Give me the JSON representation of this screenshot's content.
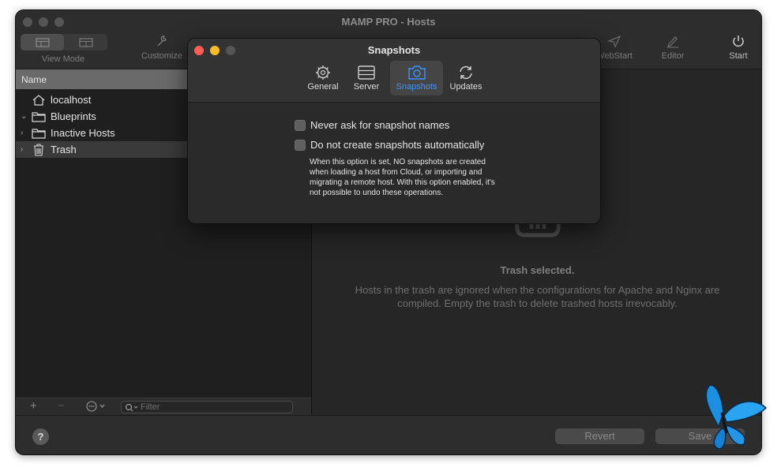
{
  "window": {
    "title": "MAMP PRO - Hosts"
  },
  "toolbar": {
    "view_mode_label": "View Mode",
    "customize_label": "Customize",
    "webstart_label": "WebStart",
    "editor_label": "Editor",
    "start_label": "Start"
  },
  "sidebar": {
    "column_header": "Name",
    "items": [
      {
        "label": "localhost",
        "icon": "home-icon"
      },
      {
        "label": "Blueprints",
        "icon": "folder-icon"
      },
      {
        "label": "Inactive Hosts",
        "icon": "folder-icon"
      },
      {
        "label": "Trash",
        "icon": "trash-icon",
        "selected": true
      }
    ],
    "filter_placeholder": "Filter"
  },
  "detail": {
    "title": "Trash selected.",
    "description": "Hosts in the trash are ignored when the configurations for Apache and Nginx are compiled. Empty the trash to delete trashed hosts irrevocably."
  },
  "bottom": {
    "help_label": "?",
    "revert_label": "Revert",
    "save_label": "Save"
  },
  "dialog": {
    "title": "Snapshots",
    "tabs": [
      {
        "label": "General",
        "icon": "gear-icon"
      },
      {
        "label": "Server",
        "icon": "server-icon"
      },
      {
        "label": "Snapshots",
        "icon": "camera-icon",
        "active": true
      },
      {
        "label": "Updates",
        "icon": "refresh-icon"
      }
    ],
    "options": [
      {
        "label": "Never ask for snapshot names",
        "checked": false
      },
      {
        "label": "Do not create snapshots automatically",
        "checked": false
      }
    ],
    "note": "When this option is set, NO snapshots are created when loading a host from Cloud, or importing and migrating a remote host. With this option enabled, it's not possible to undo these operations."
  },
  "colors": {
    "accent": "#3d95ff",
    "close": "#ff5f57",
    "minimize": "#febc2e",
    "butterfly": "#1e8fe0"
  }
}
